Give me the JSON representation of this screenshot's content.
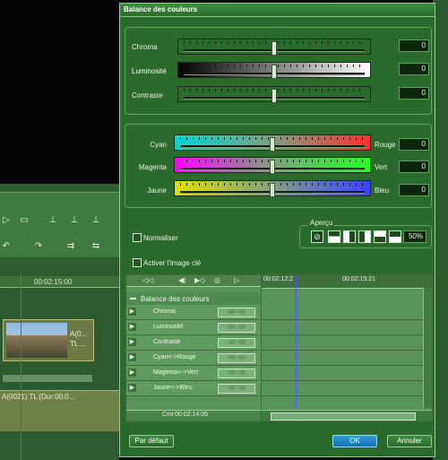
{
  "background": {
    "ruler_time": "00:02:15:00",
    "clip_label_1": "A(0...",
    "clip_label_2": "TL ...",
    "track_label": "A(0021)  TL [Dur:00:0..."
  },
  "dialog": {
    "title": "Balance des couleurs",
    "sliders_top": [
      {
        "label": "Chroma",
        "value": "0",
        "position": 0.5
      },
      {
        "label": "Luminosité",
        "value": "0",
        "position": 0.5
      },
      {
        "label": "Contraste",
        "value": "0",
        "position": 0.5
      }
    ],
    "sliders_color": [
      {
        "left_label": "Cyan",
        "right_label": "Rouge",
        "value": "0",
        "position": 0.5
      },
      {
        "left_label": "Magenta",
        "right_label": "Vert",
        "value": "0",
        "position": 0.5
      },
      {
        "left_label": "Jaune",
        "right_label": "Bleu",
        "value": "0",
        "position": 0.5
      }
    ],
    "normalize_label": "Normaliser",
    "activate_label": "Activer l'image clé",
    "preview_label": "Aperçu",
    "preview_zoom": "50%",
    "keyframe": {
      "time_start": "00:02:12:2",
      "time_end": "00:02:15:21",
      "root_label": "Balance des couleurs",
      "rows": [
        "Chroma",
        "Luminosité",
        "Contraste",
        "Cyan<->Rouge",
        "Magenta<->Vert",
        "Jaune<->Bleu"
      ],
      "cmt_label": "Cmt",
      "cmt_time": "00:02:14:05"
    },
    "buttons": {
      "default": "Par défaut",
      "ok": "OK",
      "cancel": "Annuler"
    }
  },
  "colors": {
    "dialog_bg": "#2a6a2c",
    "ok_button": "#1672b4",
    "panel_border": "#5fa45c"
  }
}
